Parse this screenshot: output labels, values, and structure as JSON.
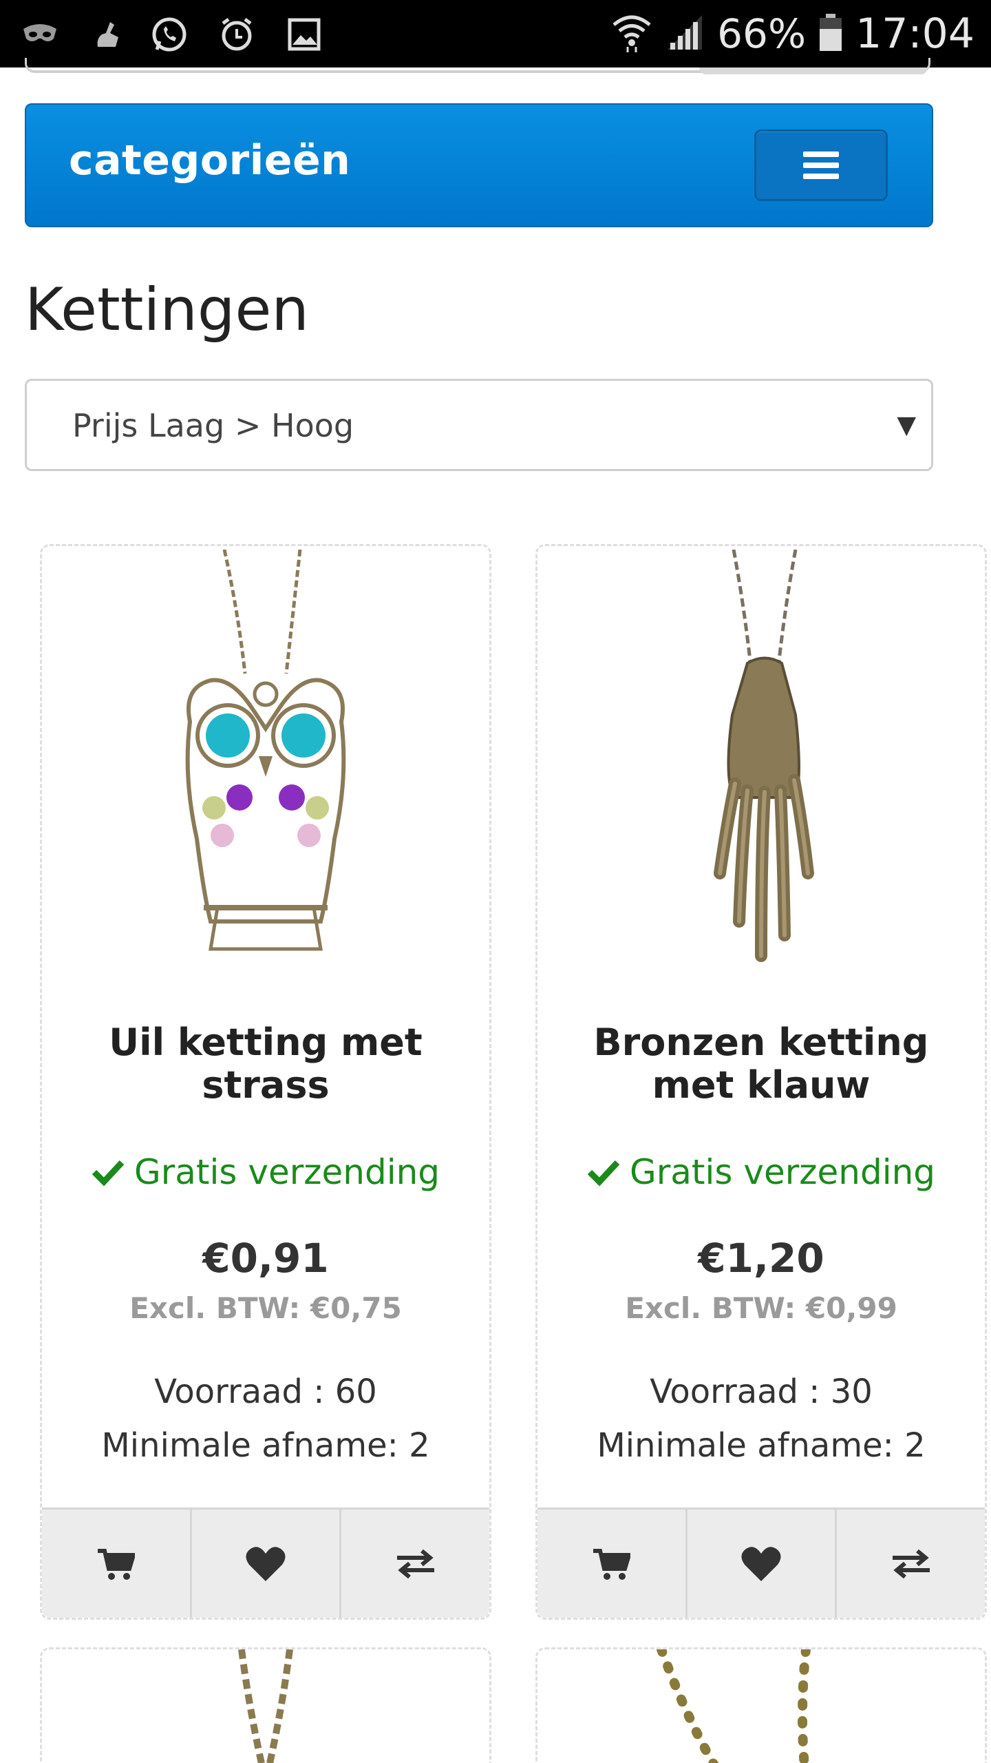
{
  "status_bar": {
    "battery_percent": "66%",
    "time": "17:04",
    "icons": [
      "incognito-icon",
      "cleaner-icon",
      "whatsapp-icon",
      "alarm-icon",
      "gallery-icon",
      "wifi-icon",
      "signal-icon",
      "battery-icon"
    ]
  },
  "header": {
    "categories_label": "categorieën",
    "menu_icon": "hamburger-icon"
  },
  "page": {
    "title": "Kettingen"
  },
  "sort": {
    "selected": "Prijs Laag > Hoog"
  },
  "products": [
    {
      "name": "Uil ketting met strass",
      "shipping": "Gratis verzending",
      "price": "€0,91",
      "excl_vat": "Excl. BTW: €0,75",
      "stock": "Voorraad : 60",
      "min_order": "Minimale afname: 2"
    },
    {
      "name": "Bronzen ketting met klauw",
      "shipping": "Gratis verzending",
      "price": "€1,20",
      "excl_vat": "Excl. BTW: €0,99",
      "stock": "Voorraad : 30",
      "min_order": "Minimale afname: 2"
    }
  ],
  "colors": {
    "accent_blue": "#0082d6",
    "shipping_green": "#1a8a1a",
    "action_bar": "#ececec"
  }
}
